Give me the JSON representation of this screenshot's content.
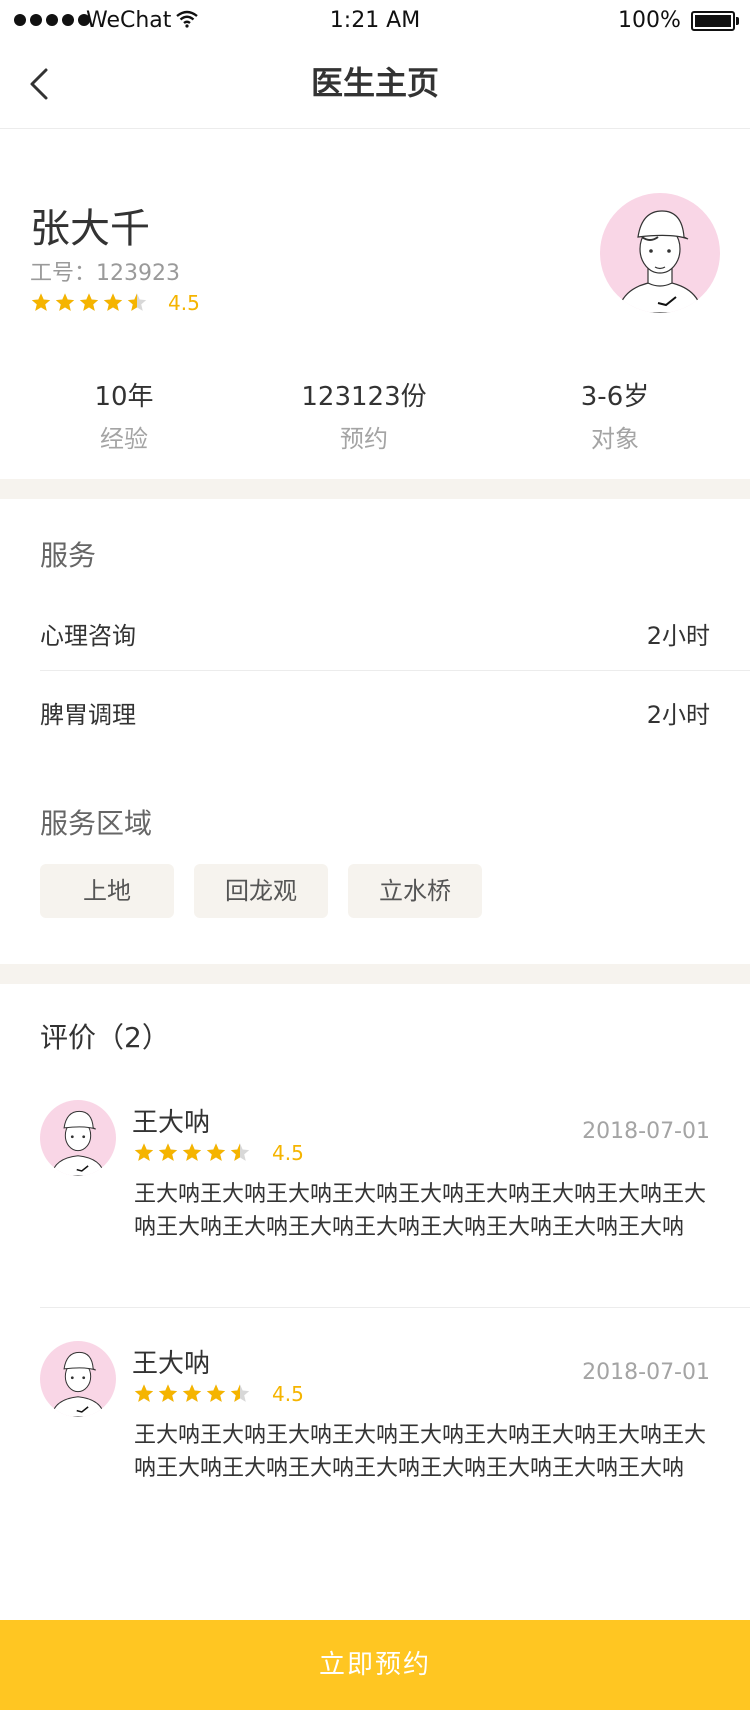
{
  "status_bar": {
    "carrier": "WeChat",
    "time": "1:21 AM",
    "battery": "100%"
  },
  "nav": {
    "title": "医生主页"
  },
  "doctor": {
    "name": "张大千",
    "employee_id": "工号：123923",
    "rating": "4.5",
    "rating_value": 4.5
  },
  "stats": [
    {
      "value": "10年",
      "label": "经验"
    },
    {
      "value": "123123份",
      "label": "预约"
    },
    {
      "value": "3-6岁",
      "label": "对象"
    }
  ],
  "services": {
    "title": "服务",
    "items": [
      {
        "name": "心理咨询",
        "duration": "2小时"
      },
      {
        "name": "脾胃调理",
        "duration": "2小时"
      }
    ]
  },
  "service_area": {
    "title": "服务区域",
    "tags": [
      "上地",
      "回龙观",
      "立水桥"
    ]
  },
  "reviews": {
    "title": "评价（2）",
    "items": [
      {
        "name": "王大呐",
        "rating": "4.5",
        "date": "2018-07-01",
        "text": "王大呐王大呐王大呐王大呐王大呐王大呐王大呐王大呐王大呐王大呐王大呐王大呐王大呐王大呐王大呐王大呐王大呐"
      },
      {
        "name": "王大呐",
        "rating": "4.5",
        "date": "2018-07-01",
        "text": "王大呐王大呐王大呐王大呐王大呐王大呐王大呐王大呐王大呐王大呐王大呐王大呐王大呐王大呐王大呐王大呐王大呐"
      }
    ]
  },
  "cta": {
    "label": "立即预约"
  },
  "colors": {
    "accent": "#ffc622",
    "star": "#f5b400",
    "star_empty": "#d8d8d8",
    "band": "#f6f3ee",
    "avatar_bg": "#f9d6e6"
  }
}
